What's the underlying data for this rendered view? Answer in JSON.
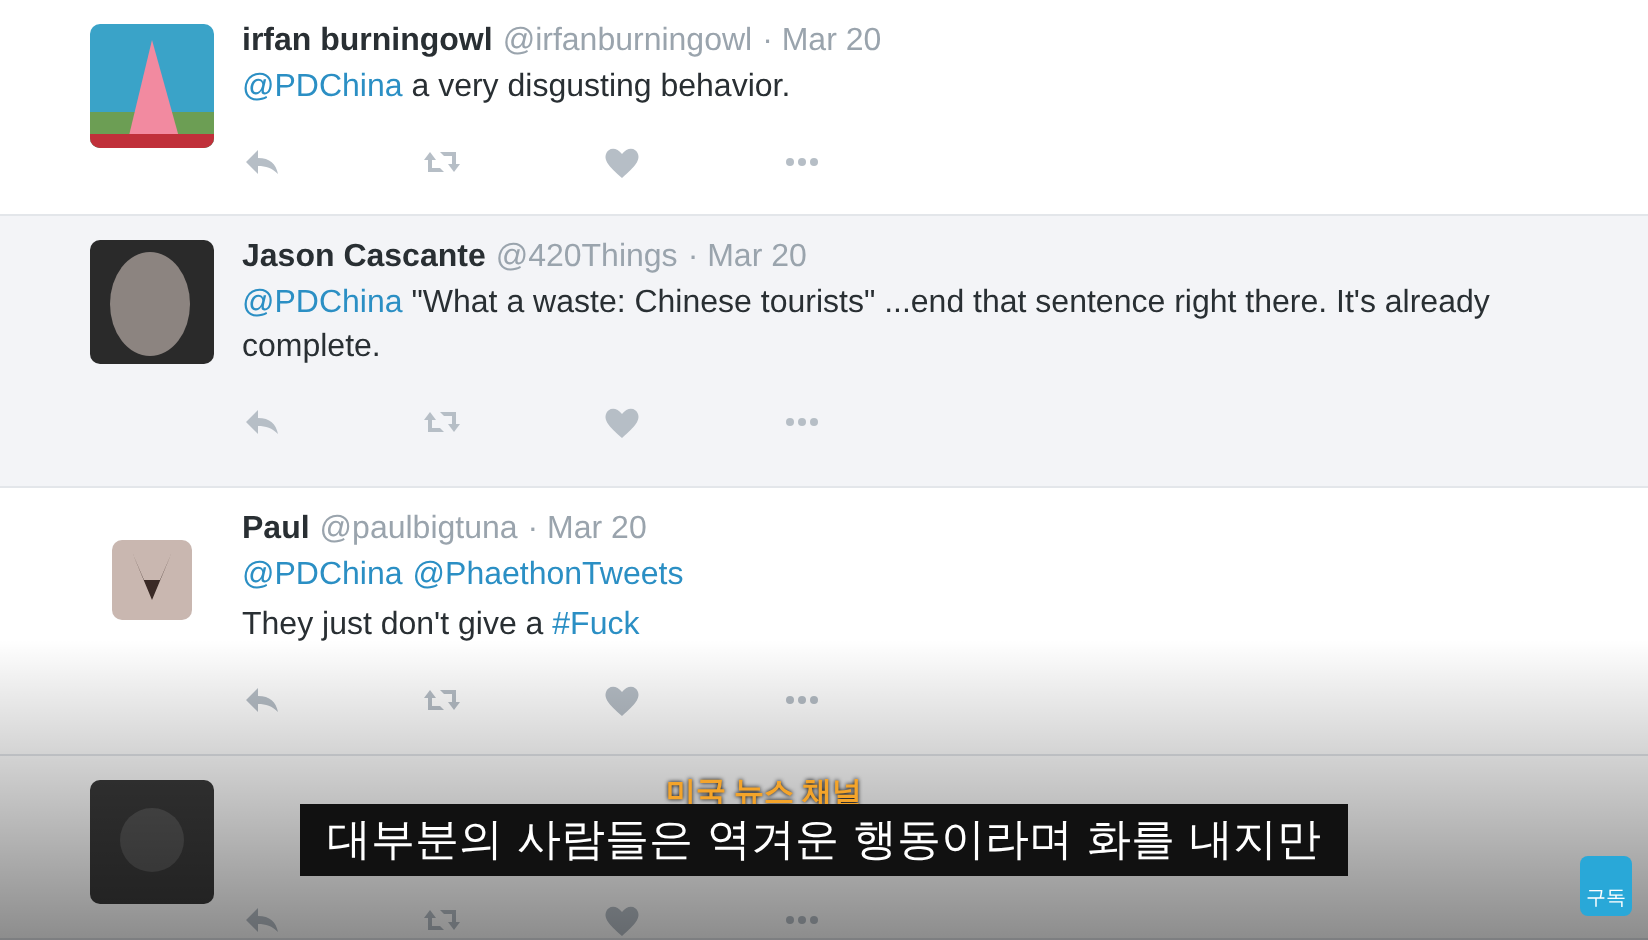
{
  "tweets": [
    {
      "name": "irfan burningowl",
      "handle": "@irfanburningowl",
      "date": "· Mar 20",
      "highlighted": false,
      "body": [
        [
          {
            "text": "@PDChina",
            "kind": "link"
          },
          {
            "text": " a very disgusting behavior.",
            "kind": "plain"
          }
        ]
      ]
    },
    {
      "name": "Jason Cascante",
      "handle": "@420Things",
      "date": "· Mar 20",
      "highlighted": true,
      "body": [
        [
          {
            "text": "@PDChina",
            "kind": "link"
          },
          {
            "text": " \"What a waste: Chinese tourists\" ...end that sentence right there. It's already complete.",
            "kind": "plain"
          }
        ]
      ]
    },
    {
      "name": "Paul",
      "handle": "@paulbigtuna",
      "date": "· Mar 20",
      "highlighted": false,
      "body": [
        [
          {
            "text": "@PDChina",
            "kind": "link"
          },
          {
            "text": "@PhaethonTweets",
            "kind": "link"
          }
        ],
        [
          {
            "text": "They just don't give a ",
            "kind": "plain"
          },
          {
            "text": "#Fuck",
            "kind": "link"
          }
        ]
      ]
    },
    {
      "kind": "covered"
    }
  ],
  "caption": {
    "label": "미국 뉴스 채널",
    "subtitle": "대부분의 사람들은 역겨운 행동이라며 화를 내지만",
    "subscribe": "구독"
  }
}
